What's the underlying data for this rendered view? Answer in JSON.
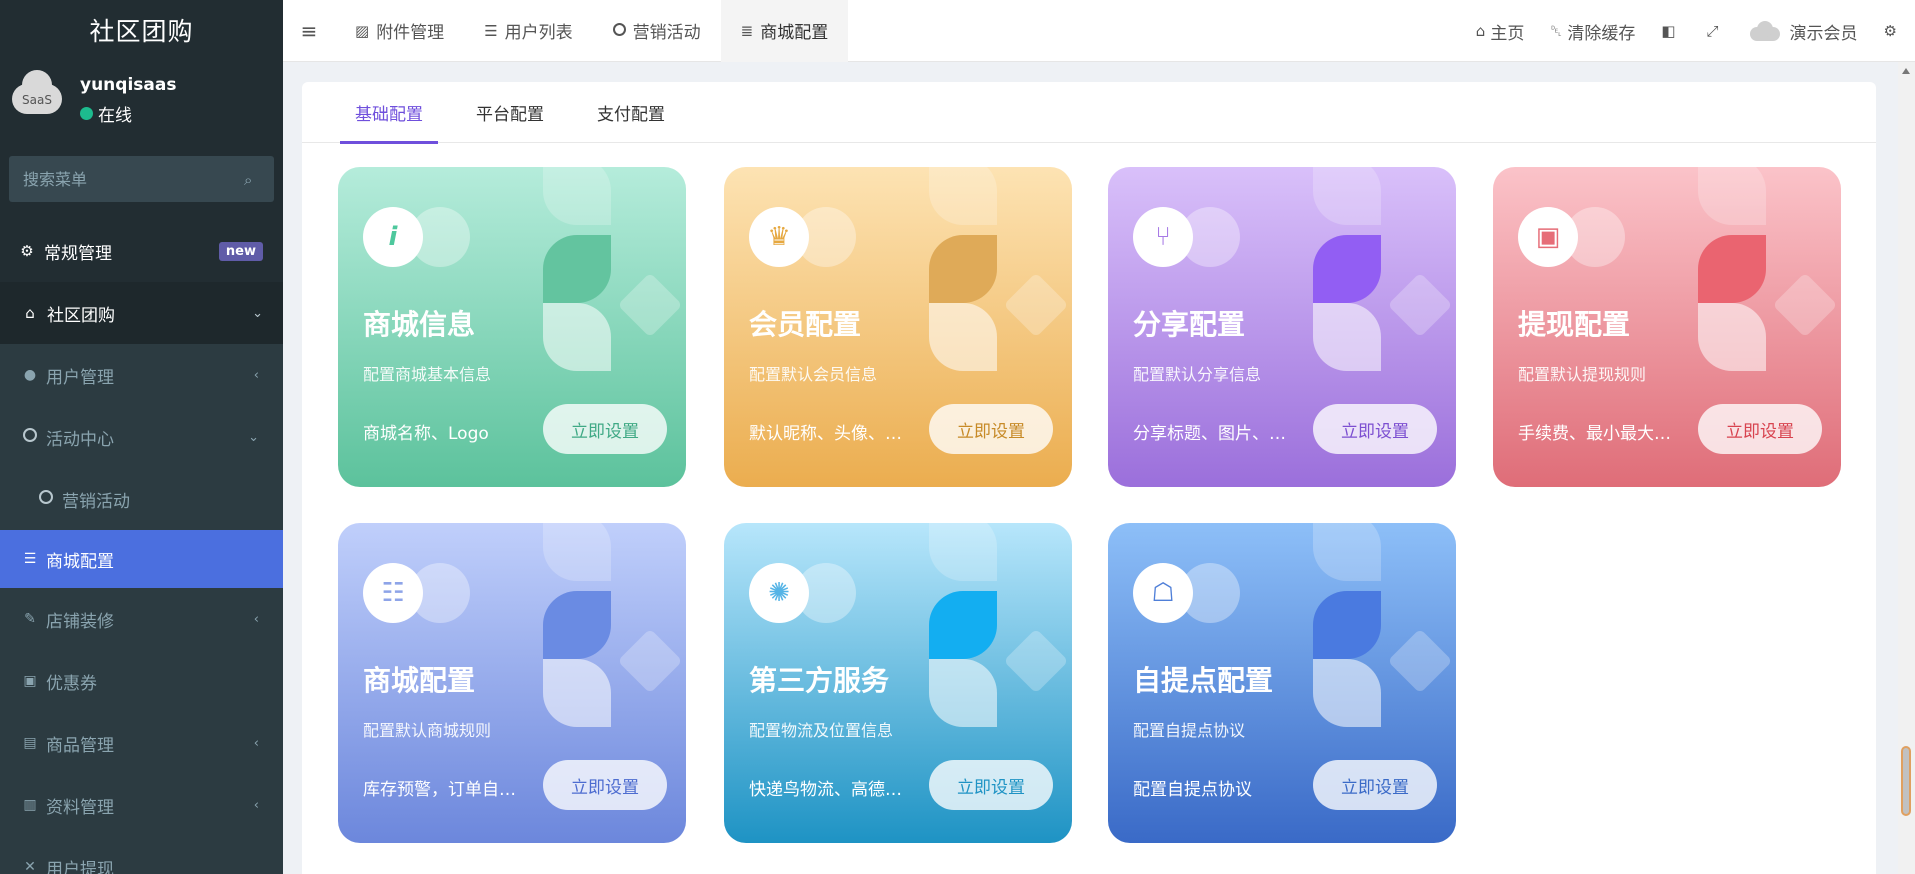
{
  "sidebar": {
    "brand": "社区团购",
    "user": {
      "name": "yunqisaas",
      "status": "在线",
      "avatar_text": "SaaS"
    },
    "search_placeholder": "搜索菜单",
    "items": [
      {
        "label": "常规管理",
        "badge": "new"
      },
      {
        "label": "社区团购"
      },
      {
        "label": "用户管理"
      },
      {
        "label": "活动中心"
      },
      {
        "label": "营销活动"
      },
      {
        "label": "商城配置"
      },
      {
        "label": "店铺装修"
      },
      {
        "label": "优惠券"
      },
      {
        "label": "商品管理"
      },
      {
        "label": "资料管理"
      },
      {
        "label": "用户提现"
      }
    ]
  },
  "topbar": {
    "tabs": [
      {
        "label": "附件管理"
      },
      {
        "label": "用户列表"
      },
      {
        "label": "营销活动"
      },
      {
        "label": "商城配置"
      }
    ],
    "right": {
      "home": "主页",
      "clear_cache": "清除缓存",
      "member": "演示会员"
    }
  },
  "content": {
    "subtabs": [
      "基础配置",
      "平台配置",
      "支付配置"
    ],
    "button_label": "立即设置",
    "cards": [
      {
        "title": "商城信息",
        "desc": "配置商城基本信息",
        "foot": "商城名称、Logo"
      },
      {
        "title": "会员配置",
        "desc": "配置默认会员信息",
        "foot": "默认昵称、头像、…"
      },
      {
        "title": "分享配置",
        "desc": "配置默认分享信息",
        "foot": "分享标题、图片、…"
      },
      {
        "title": "提现配置",
        "desc": "配置默认提现规则",
        "foot": "手续费、最小最大…"
      },
      {
        "title": "商城配置",
        "desc": "配置默认商城规则",
        "foot": "库存预警，订单自…"
      },
      {
        "title": "第三方服务",
        "desc": "配置物流及位置信息",
        "foot": "快递鸟物流、高德…"
      },
      {
        "title": "自提点配置",
        "desc": "配置自提点协议",
        "foot": "配置自提点协议"
      }
    ]
  }
}
